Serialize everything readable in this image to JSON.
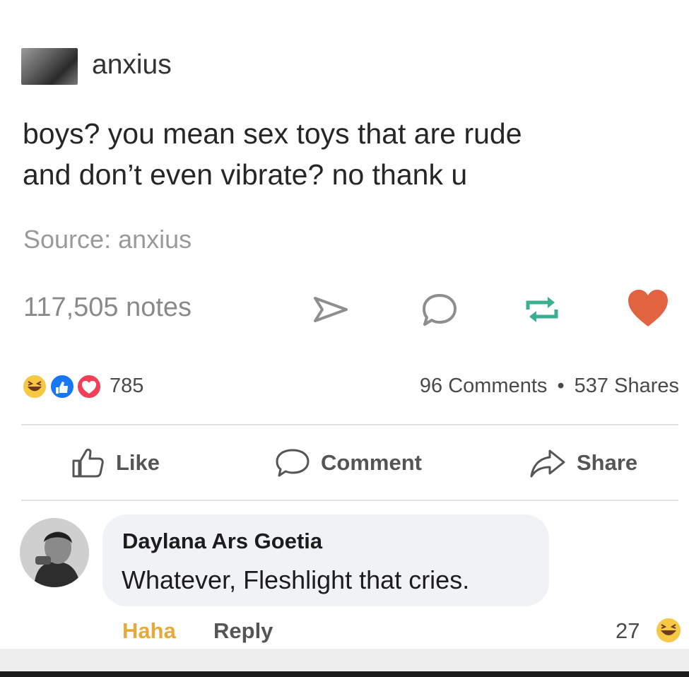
{
  "post": {
    "username": "anxius",
    "text_line1": "boys? you mean sex toys that are rude",
    "text_line2": "and don’t even vibrate? no thank u",
    "source": "Source: anxius",
    "notes": "117,505 notes",
    "icons": [
      "share-arrow-icon",
      "reply-bubble-icon",
      "reblog-icon",
      "heart-icon"
    ],
    "heart_color": "#e1633f"
  },
  "facebook": {
    "reaction_count": "785",
    "comments": "96 Comments",
    "separator": "•",
    "shares": "537 Shares",
    "actions": {
      "like": "Like",
      "comment": "Comment",
      "share": "Share"
    },
    "comment": {
      "author": "Daylana Ars Goetia",
      "text": "Whatever, Fleshlight that cries.",
      "haha": "Haha",
      "reply": "Reply",
      "likes": "27"
    },
    "colors": {
      "haha_label": "#e8a93b",
      "like_blue": "#1877f2",
      "love_red": "#f33e58",
      "haha_yellow": "#f7c843"
    }
  }
}
